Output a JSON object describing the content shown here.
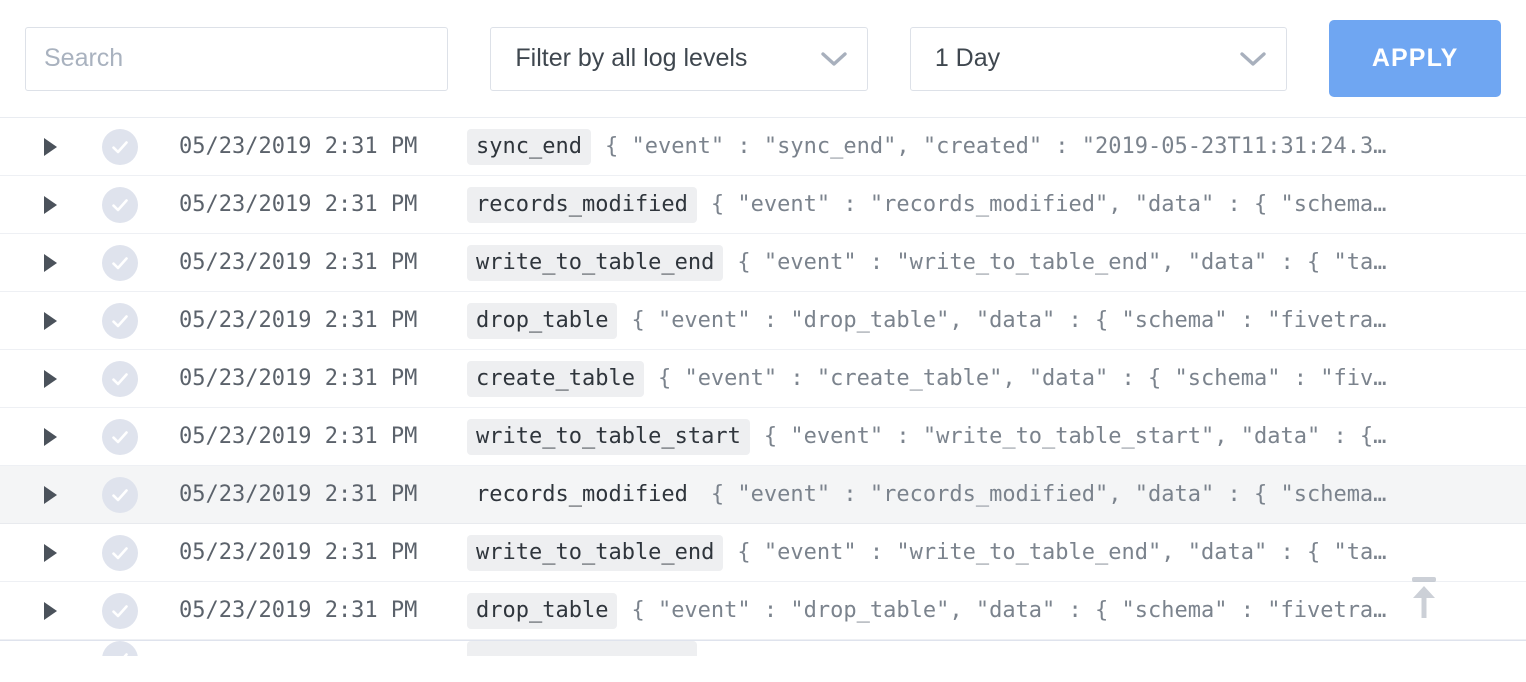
{
  "toolbar": {
    "search": {
      "value": "",
      "placeholder": "Search"
    },
    "log_level_select": {
      "value": "Filter by all log levels",
      "icon": "chevron-down-icon"
    },
    "time_range_select": {
      "value": "1 Day",
      "icon": "chevron-down-icon"
    },
    "apply_label": "APPLY",
    "accent_color": "#6fa6f2",
    "border_color": "#dde1e8"
  },
  "log_list": {
    "status_icon": "check-circle-icon",
    "expand_icon": "triangle-right-icon",
    "scroll_top_icon": "scroll-to-top-icon",
    "rows": [
      {
        "timestamp": "05/23/2019 2:31 PM",
        "event": "sync_end",
        "json": "{ \"event\" : \"sync_end\", \"created\" : \"2019-05-23T11:31:24.3…",
        "highlight": false
      },
      {
        "timestamp": "05/23/2019 2:31 PM",
        "event": "records_modified",
        "json": "{ \"event\" : \"records_modified\", \"data\" : { \"schema…",
        "highlight": false
      },
      {
        "timestamp": "05/23/2019 2:31 PM",
        "event": "write_to_table_end",
        "json": "{ \"event\" : \"write_to_table_end\", \"data\" : { \"ta…",
        "highlight": false
      },
      {
        "timestamp": "05/23/2019 2:31 PM",
        "event": "drop_table",
        "json": "{ \"event\" : \"drop_table\", \"data\" : { \"schema\" : \"fivetra…",
        "highlight": false
      },
      {
        "timestamp": "05/23/2019 2:31 PM",
        "event": "create_table",
        "json": "{ \"event\" : \"create_table\", \"data\" : { \"schema\" : \"fiv…",
        "highlight": false
      },
      {
        "timestamp": "05/23/2019 2:31 PM",
        "event": "write_to_table_start",
        "json": "{ \"event\" : \"write_to_table_start\", \"data\" : {…",
        "highlight": false
      },
      {
        "timestamp": "05/23/2019 2:31 PM",
        "event": "records_modified",
        "json": "{ \"event\" : \"records_modified\", \"data\" : { \"schema…",
        "highlight": true
      },
      {
        "timestamp": "05/23/2019 2:31 PM",
        "event": "write_to_table_end",
        "json": "{ \"event\" : \"write_to_table_end\", \"data\" : { \"ta…",
        "highlight": false
      },
      {
        "timestamp": "05/23/2019 2:31 PM",
        "event": "drop_table",
        "json": "{ \"event\" : \"drop_table\", \"data\" : { \"schema\" : \"fivetra…",
        "highlight": false
      }
    ]
  }
}
